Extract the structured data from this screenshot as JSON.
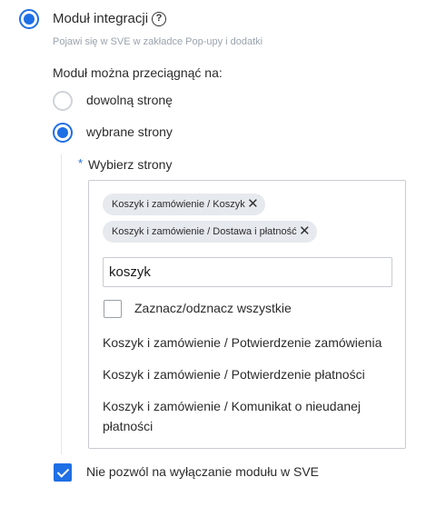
{
  "module": {
    "title": "Moduł integracji",
    "help_icon": "question-circle-icon",
    "subtitle": "Pojawi się w SVE w zakładce Pop-upy i dodatki"
  },
  "drag": {
    "label": "Moduł można przeciągnąć na:",
    "options": [
      {
        "label": "dowolną stronę",
        "selected": false
      },
      {
        "label": "wybrane strony",
        "selected": true
      }
    ]
  },
  "pages": {
    "required_mark": "*",
    "label": "Wybierz strony",
    "selected_chips": [
      "Koszyk i zamówienie / Koszyk",
      "Koszyk i zamówienie / Dostawa i płatność"
    ],
    "search_value": "koszyk",
    "select_all_label": "Zaznacz/odznacz wszystkie",
    "results": [
      "Koszyk i zamówienie / Potwierdzenie zamówienia",
      "Koszyk i zamówienie / Potwierdzenie płatności",
      "Koszyk i zamówienie / Komunikat o nieudanej płatności"
    ]
  },
  "disable_toggle": {
    "label": "Nie pozwól na wyłączanie modułu w SVE",
    "checked": true
  },
  "colors": {
    "accent": "#1f6fe5",
    "required": "#1f6fe5",
    "subtle_text": "#9aa3ad"
  }
}
